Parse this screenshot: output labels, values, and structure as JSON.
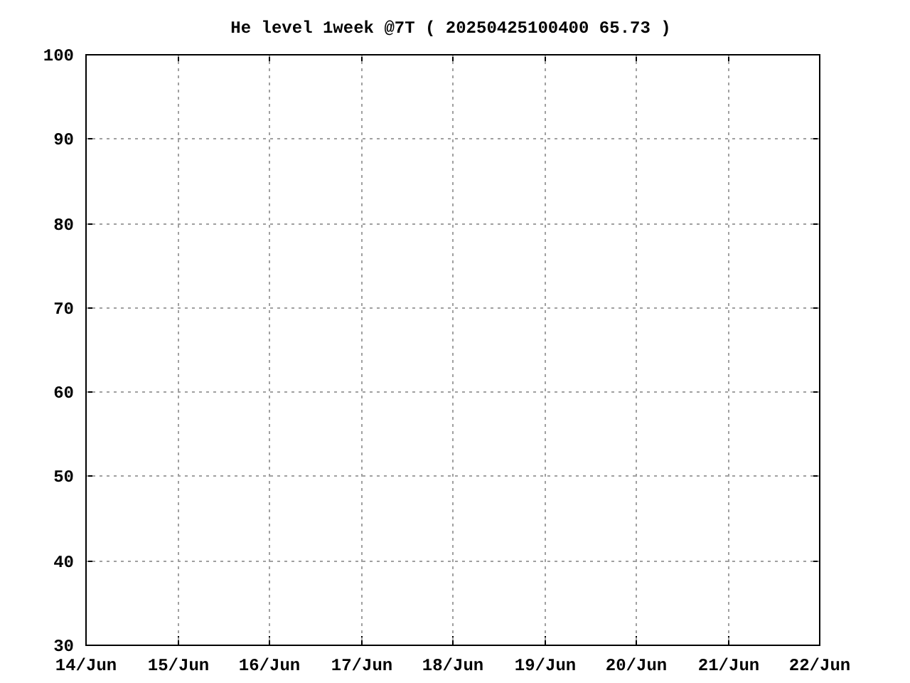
{
  "chart_data": {
    "type": "line",
    "grid": true,
    "title": "He level 1week @7T ( 20250425100400 65.73 )",
    "ylim": [
      30,
      100
    ],
    "categories": [
      "14/Jun",
      "15/Jun",
      "16/Jun",
      "17/Jun",
      "18/Jun",
      "19/Jun",
      "20/Jun",
      "21/Jun",
      "22/Jun"
    ],
    "yticks": [
      30,
      40,
      50,
      60,
      70,
      80,
      90,
      100
    ]
  }
}
